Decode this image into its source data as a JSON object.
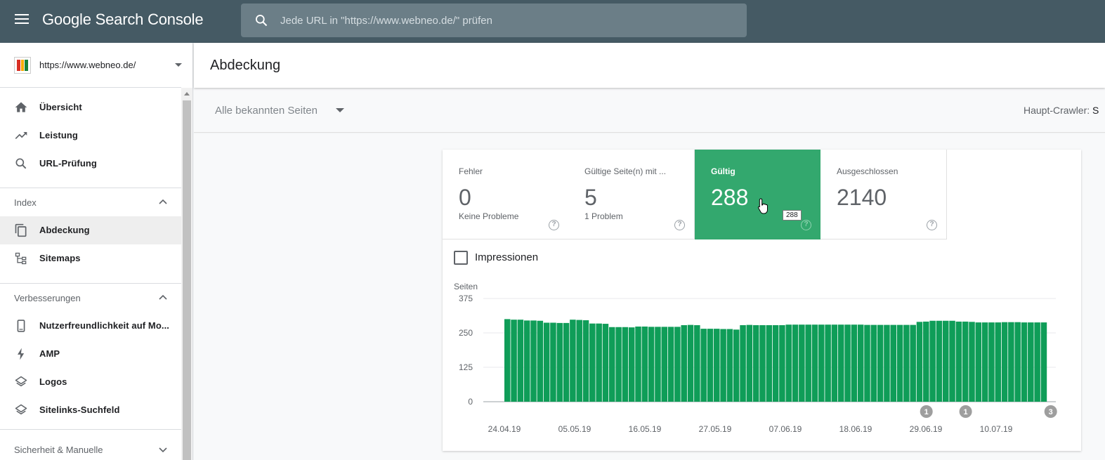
{
  "topbar": {
    "brand": "Google Search Console",
    "search_placeholder": "Jede URL in \"https://www.webneo.de/\" prüfen"
  },
  "property": {
    "url": "https://www.webneo.de/"
  },
  "sidebar": {
    "items": [
      {
        "label": "Übersicht",
        "icon": "home-icon"
      },
      {
        "label": "Leistung",
        "icon": "trending-up-icon"
      },
      {
        "label": "URL-Prüfung",
        "icon": "search-icon"
      }
    ],
    "section_index": {
      "label": "Index",
      "items": [
        {
          "label": "Abdeckung",
          "icon": "pages-icon",
          "active": true
        },
        {
          "label": "Sitemaps",
          "icon": "sitemap-icon"
        }
      ]
    },
    "section_improvements": {
      "label": "Verbesserungen",
      "items": [
        {
          "label": "Nutzerfreundlichkeit auf Mo...",
          "icon": "smartphone-icon"
        },
        {
          "label": "AMP",
          "icon": "bolt-icon"
        },
        {
          "label": "Logos",
          "icon": "layers-icon"
        },
        {
          "label": "Sitelinks-Suchfeld",
          "icon": "layers-icon"
        }
      ]
    },
    "section_security": {
      "label": "Sicherheit & Manuelle"
    }
  },
  "header": {
    "title": "Abdeckung"
  },
  "filter": {
    "selected": "Alle bekannten Seiten",
    "crawler_label": "Haupt-Crawler:",
    "crawler_value": "S"
  },
  "tiles": [
    {
      "title": "Fehler",
      "value": "0",
      "sub": "Keine Probleme",
      "active": false
    },
    {
      "title": "Gültige Seite(n) mit ...",
      "value": "5",
      "sub": "1 Problem",
      "active": false
    },
    {
      "title": "Gültig",
      "value": "288",
      "sub": "",
      "active": true
    },
    {
      "title": "Ausgeschlossen",
      "value": "2140",
      "sub": "",
      "active": false
    }
  ],
  "tooltip": "288",
  "impressions_label": "Impressionen",
  "colors": {
    "accent": "#33a86e",
    "bar": "#0f9d58",
    "topbar": "#455a64"
  },
  "chart_data": {
    "type": "bar",
    "ylabel": "Seiten",
    "ylim": [
      0,
      375
    ],
    "yticks": [
      "375",
      "250",
      "125",
      "0"
    ],
    "xticks": [
      "24.04.19",
      "05.05.19",
      "16.05.19",
      "27.05.19",
      "07.06.19",
      "18.06.19",
      "29.06.19",
      "10.07.19"
    ],
    "values": [
      300,
      298,
      298,
      295,
      295,
      294,
      287,
      287,
      286,
      286,
      298,
      297,
      296,
      284,
      284,
      283,
      271,
      271,
      271,
      270,
      273,
      273,
      272,
      272,
      272,
      272,
      272,
      278,
      279,
      278,
      265,
      265,
      265,
      264,
      264,
      262,
      278,
      279,
      278,
      278,
      278,
      278,
      278,
      280,
      280,
      280,
      280,
      280,
      280,
      280,
      280,
      280,
      280,
      280,
      280,
      279,
      279,
      279,
      279,
      279,
      279,
      279,
      279,
      290,
      291,
      294,
      294,
      294,
      294,
      291,
      291,
      290,
      288,
      288,
      288,
      288,
      289,
      289,
      289,
      288,
      288,
      288,
      288
    ],
    "annotations": [
      {
        "label": "1",
        "index": 64
      },
      {
        "label": "1",
        "index": 70
      },
      {
        "label": "3",
        "index": 83
      }
    ]
  }
}
